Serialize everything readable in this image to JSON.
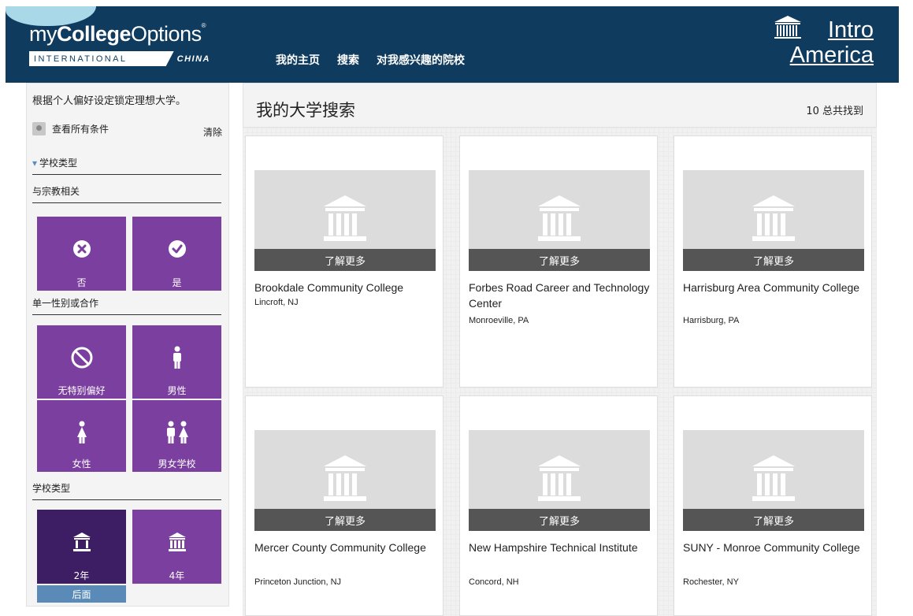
{
  "header": {
    "logo_prefix": "my",
    "logo_bold": "College",
    "logo_rest": "Options",
    "logo_mark": "®",
    "logo_international": "INTERNATIONAL",
    "logo_region": "CHINA",
    "nav": [
      "我的主页",
      "搜索",
      "对我感兴趣的院校"
    ],
    "brand_line1": "Intro",
    "brand_line2": "America"
  },
  "sidebar": {
    "title": "根据个人偏好设定锁定理想大学。",
    "view_all": "查看所有条件",
    "clear": "清除",
    "section_school_type": "学校类型",
    "religious": {
      "label": "与宗教相关",
      "options": [
        {
          "label": "否",
          "icon": "x-circle-icon"
        },
        {
          "label": "是",
          "icon": "check-circle-icon"
        }
      ]
    },
    "gender": {
      "label": "单一性别或合作",
      "options": [
        {
          "label": "无特别偏好",
          "icon": "no-preference-icon"
        },
        {
          "label": "男性",
          "icon": "male-icon"
        },
        {
          "label": "女性",
          "icon": "female-icon"
        },
        {
          "label": "男女学校",
          "icon": "coed-icon"
        }
      ]
    },
    "type": {
      "label": "学校类型",
      "options": [
        {
          "label": "2年",
          "icon": "building-small-icon",
          "selected": true
        },
        {
          "label": "4年",
          "icon": "building-large-icon",
          "selected": false
        }
      ]
    },
    "back": "后面"
  },
  "main": {
    "title": "我的大学搜索",
    "count": "10 总共找到",
    "learn_more": "了解更多",
    "colleges": [
      {
        "name": "Brookdale Community College",
        "location": "Lincroft, NJ"
      },
      {
        "name": "Forbes Road Career and Technology Center",
        "location": "Monroeville, PA"
      },
      {
        "name": "Harrisburg Area Community College",
        "location": "Harrisburg, PA"
      },
      {
        "name": "Mercer County Community College",
        "location": "Princeton Junction, NJ"
      },
      {
        "name": "New Hampshire Technical Institute",
        "location": "Concord, NH"
      },
      {
        "name": "SUNY - Monroe Community College",
        "location": "Rochester, NY"
      }
    ]
  },
  "colors": {
    "header_bg": "#0f3b5f",
    "tile_purple": "#7b3fa0",
    "tile_selected": "#3d1d63",
    "back_button": "#5a8bb8",
    "learn_more_bar": "#555555"
  }
}
